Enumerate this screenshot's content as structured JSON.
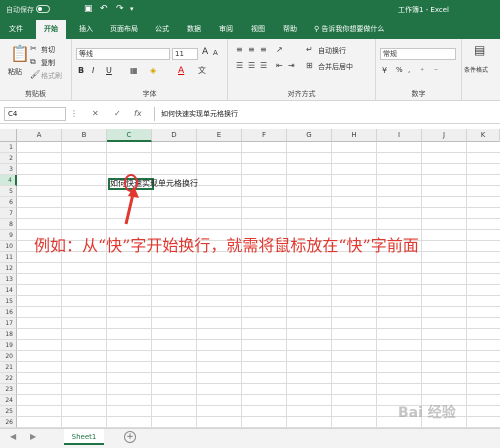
{
  "titlebar": {
    "autosave": "自动保存",
    "autosave_state": "关",
    "title": "工作簿1 - Excel"
  },
  "tabs": [
    "文件",
    "开始",
    "插入",
    "页面布局",
    "公式",
    "数据",
    "审阅",
    "视图",
    "帮助"
  ],
  "active_tab": "开始",
  "tellme": "告诉我你想要做什么",
  "ribbon": {
    "clipboard": {
      "paste": "粘贴",
      "cut": "剪切",
      "copy": "复制",
      "painter": "格式刷",
      "label": "剪贴板"
    },
    "font": {
      "name": "等线",
      "size": "11",
      "bold": "B",
      "italic": "I",
      "underline": "U",
      "grow": "A",
      "shrink": "A",
      "fontcolor": "A",
      "label": "字体"
    },
    "alignment": {
      "wrap": "自动换行",
      "merge": "合并后居中",
      "label": "对齐方式"
    },
    "number": {
      "format": "常规",
      "label": "数字",
      "pct": "%",
      "comma": ","
    },
    "styles": {
      "conditional": "条件格式"
    }
  },
  "formula": {
    "namebox": "C4",
    "cancel": "✕",
    "enter": "✓",
    "fx": "fx",
    "value": "如何快速实现单元格换行"
  },
  "grid": {
    "columns": [
      "A",
      "B",
      "C",
      "D",
      "E",
      "F",
      "G",
      "H",
      "I",
      "J",
      "K"
    ],
    "selected_column": "C",
    "rows": [
      "1",
      "2",
      "3",
      "4",
      "5",
      "6",
      "7",
      "8",
      "9",
      "10",
      "11",
      "12",
      "13",
      "14",
      "15",
      "16",
      "17",
      "18",
      "19",
      "20",
      "21",
      "22",
      "23",
      "24",
      "25",
      "26"
    ],
    "selected_row": "4",
    "cell_c4": "如何快速实现单元格换行"
  },
  "annotation": "例如：从“快”字开始换行，就需将鼠标放在“快”字前面",
  "annotation_color": "#e0382f",
  "accent_color": "#217346",
  "sheets": [
    "Sheet1"
  ],
  "watermark": "Bai 经验"
}
